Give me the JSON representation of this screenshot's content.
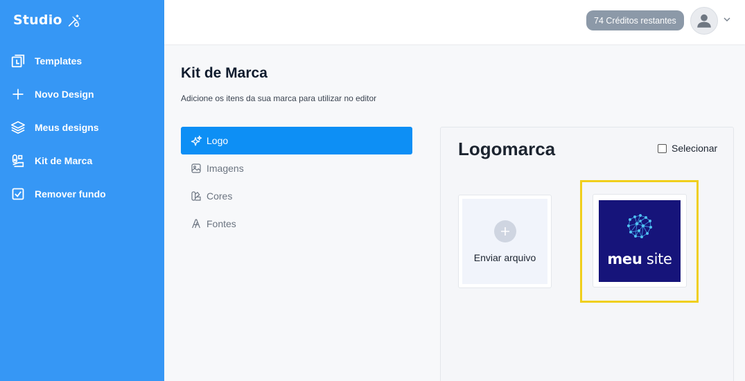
{
  "sidebar": {
    "brand": "Studio",
    "brand_icon": "magic-wand-icon",
    "items": [
      {
        "label": "Templates",
        "icon": "templates-icon"
      },
      {
        "label": "Novo Design",
        "icon": "plus-icon"
      },
      {
        "label": "Meus designs",
        "icon": "layers-icon"
      },
      {
        "label": "Kit de Marca",
        "icon": "brand-kit-icon"
      },
      {
        "label": "Remover fundo",
        "icon": "checkbox-icon"
      }
    ]
  },
  "header": {
    "credits": "74 Créditos restantes",
    "avatar_icon": "user-avatar-icon",
    "dropdown_icon": "chevron-down-icon"
  },
  "page": {
    "title": "Kit de Marca",
    "subtitle": "Adicione os itens da sua marca para utilizar no editor"
  },
  "menu": {
    "items": [
      {
        "label": "Logo",
        "icon": "sparkle-icon",
        "active": true
      },
      {
        "label": "Imagens",
        "icon": "image-icon",
        "active": false
      },
      {
        "label": "Cores",
        "icon": "palette-icon",
        "active": false
      },
      {
        "label": "Fontes",
        "icon": "font-icon",
        "active": false
      }
    ]
  },
  "panel": {
    "title": "Logomarca",
    "select_label": "Selecionar",
    "upload_label": "Enviar arquivo",
    "logo": {
      "word1": "meu",
      "word2": "site"
    }
  },
  "colors": {
    "sidebar": "#3697f5",
    "active_menu": "#0d8ff5",
    "highlight": "#f0cf1c",
    "logo_bg": "#16147a",
    "credits_badge": "#8c99a8"
  }
}
